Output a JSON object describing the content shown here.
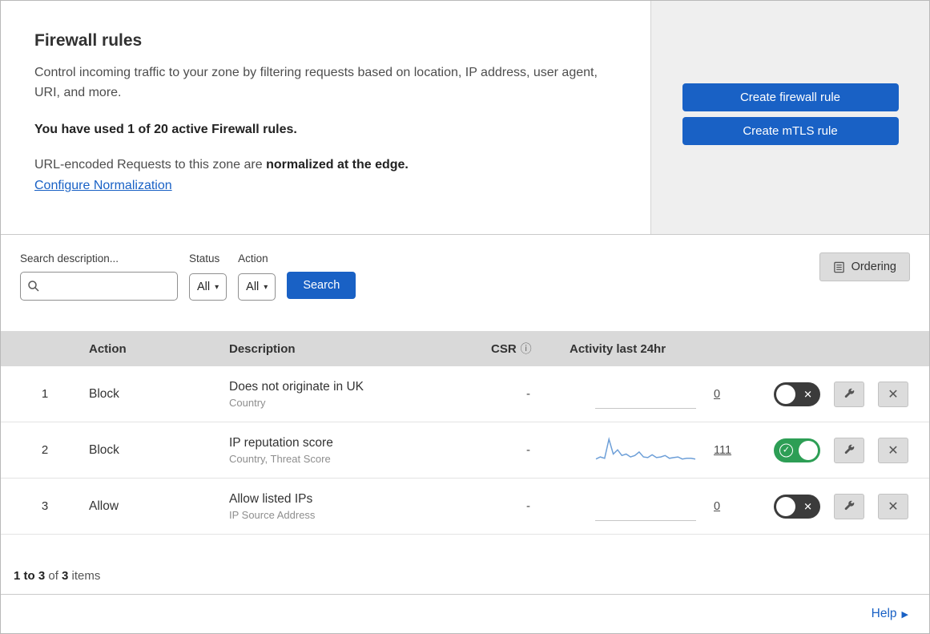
{
  "header": {
    "title": "Firewall rules",
    "description": "Control incoming traffic to your zone by filtering requests based on location, IP address, user agent, URI, and more.",
    "usage_bold": "You have used 1 of 20 active Firewall rules.",
    "normalization_prefix": "URL-encoded Requests to this zone are ",
    "normalization_bold": "normalized at the edge.",
    "normalization_link": "Configure Normalization",
    "create_firewall_button": "Create firewall rule",
    "create_mtls_button": "Create mTLS rule"
  },
  "filters": {
    "search_label": "Search description...",
    "status_label": "Status",
    "status_value": "All",
    "action_label": "Action",
    "action_value": "All",
    "search_button": "Search",
    "ordering_button": "Ordering"
  },
  "table": {
    "columns": {
      "action": "Action",
      "description": "Description",
      "csr": "CSR",
      "activity": "Activity last 24hr"
    },
    "rows": [
      {
        "num": "1",
        "action": "Block",
        "description": "Does not originate in UK",
        "fields": "Country",
        "csr": "-",
        "activity_count": "0",
        "enabled": false,
        "sparkline": []
      },
      {
        "num": "2",
        "action": "Block",
        "description": "IP reputation score",
        "fields": "Country, Threat Score",
        "csr": "-",
        "activity_count": "111",
        "enabled": true,
        "sparkline": [
          6,
          9,
          7,
          34,
          13,
          19,
          11,
          13,
          9,
          11,
          16,
          9,
          8,
          12,
          8,
          9,
          11,
          7,
          8,
          9,
          6,
          7,
          7,
          6
        ]
      },
      {
        "num": "3",
        "action": "Allow",
        "description": "Allow listed IPs",
        "fields": "IP Source Address",
        "csr": "-",
        "activity_count": "0",
        "enabled": false,
        "sparkline": []
      }
    ]
  },
  "footer": {
    "range_bold": "1 to 3",
    "of_text": " of ",
    "total_bold": "3",
    "items_text": " items",
    "help": "Help"
  },
  "colors": {
    "primary_blue": "#1961c5",
    "toggle_green": "#2d9e55",
    "toggle_off": "#3b3b3b",
    "sparkline_blue": "#6d9fd8"
  }
}
